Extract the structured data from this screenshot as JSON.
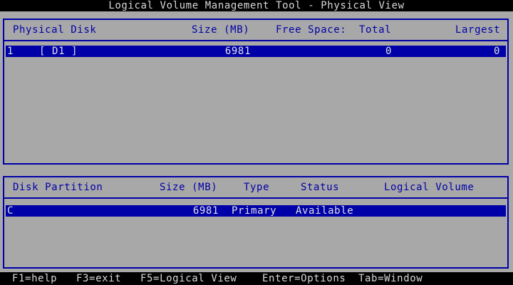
{
  "title": "Logical Volume Management Tool - Physical View",
  "physical": {
    "headers": {
      "disk": "Physical Disk",
      "size": "Size (MB)",
      "free": "Free Space:",
      "total": "Total",
      "largest": "Largest"
    },
    "rows": [
      {
        "index": "1",
        "name": "[ D1 ]",
        "size": "6981",
        "total": "0",
        "largest": "0"
      }
    ]
  },
  "partition": {
    "headers": {
      "partition": "Disk Partition",
      "size": "Size (MB)",
      "type": "Type",
      "status": "Status",
      "volume": "Logical Volume"
    },
    "rows": [
      {
        "partition": "C",
        "size": "6981",
        "type": "Primary",
        "status": "Available",
        "volume": ""
      }
    ]
  },
  "footer": {
    "help": "F1=help",
    "exit": "F3=exit",
    "logical": "F5=Logical View",
    "options": "Enter=Options",
    "window": "Tab=Window"
  },
  "colors": {
    "background": "#a8a8a8",
    "border": "#0000a8",
    "highlight": "#0000a8",
    "bar": "#000000"
  }
}
